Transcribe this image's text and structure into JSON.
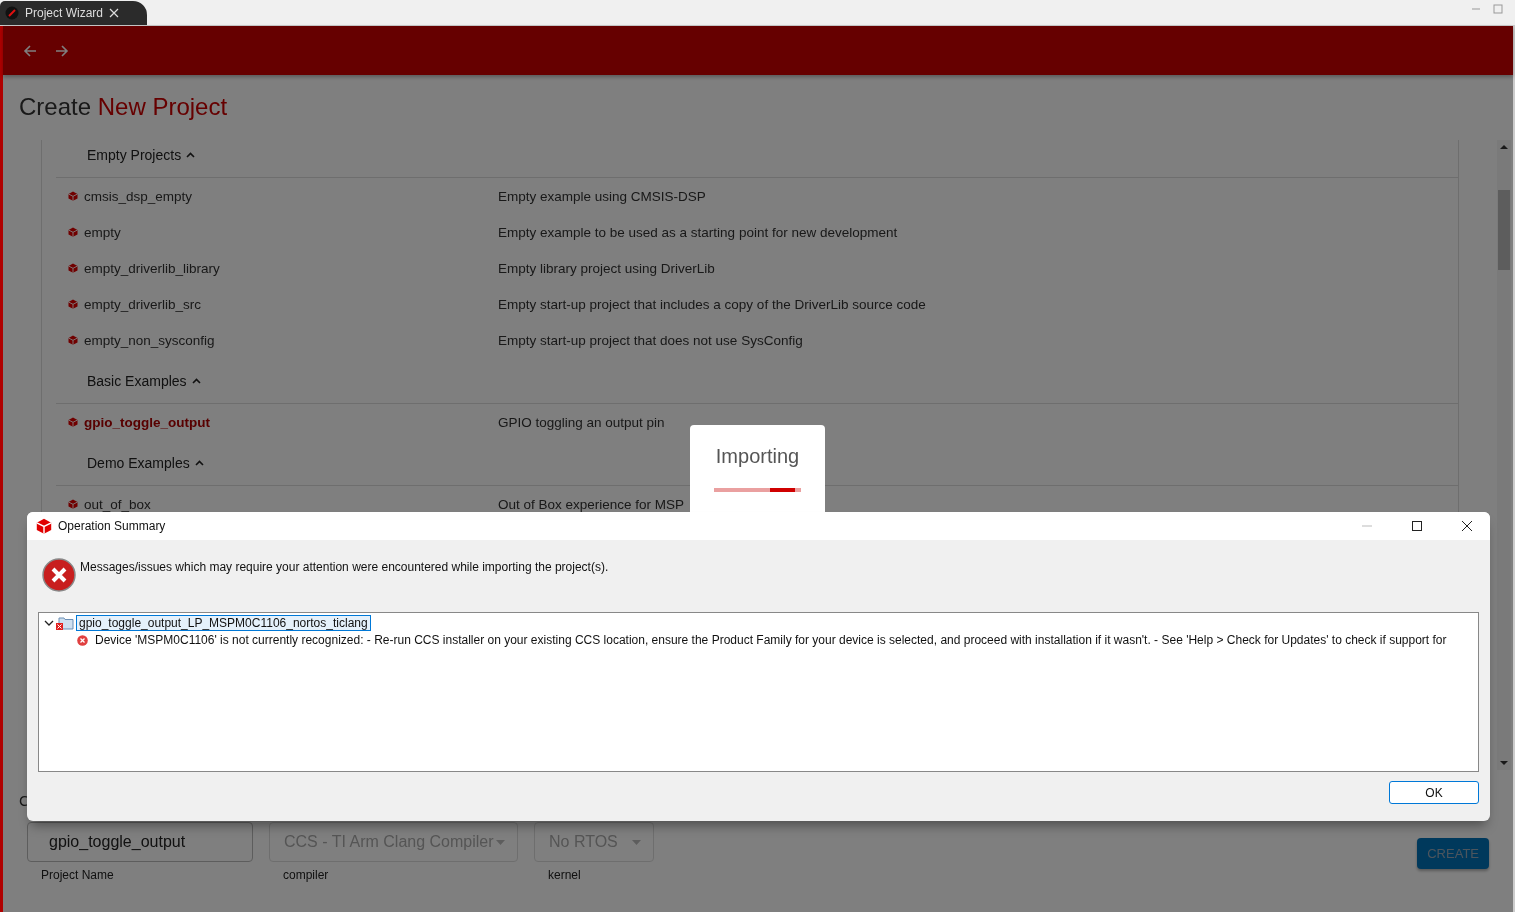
{
  "window": {
    "tab_title": "Project Wizard"
  },
  "page": {
    "title_plain": "Create",
    "title_accent": "New Project",
    "sections": [
      {
        "heading": "Empty Projects",
        "expanded": true,
        "items": [
          {
            "name": "cmsis_dsp_empty",
            "description": "Empty example using CMSIS-DSP",
            "selected": false
          },
          {
            "name": "empty",
            "description": "Empty example to be used as a starting point for new development",
            "selected": false
          },
          {
            "name": "empty_driverlib_library",
            "description": "Empty library project using DriverLib",
            "selected": false
          },
          {
            "name": "empty_driverlib_src",
            "description": "Empty start-up project that includes a copy of the DriverLib source code",
            "selected": false
          },
          {
            "name": "empty_non_sysconfig",
            "description": "Empty start-up project that does not use SysConfig",
            "selected": false
          }
        ]
      },
      {
        "heading": "Basic Examples",
        "expanded": true,
        "items": [
          {
            "name": "gpio_toggle_output",
            "description": "GPIO toggling an output pin",
            "selected": true
          }
        ]
      },
      {
        "heading": "Demo Examples",
        "expanded": true,
        "items": [
          {
            "name": "out_of_box",
            "description": "Out of Box experience for MSP",
            "selected": false
          }
        ]
      }
    ],
    "configure_heading": "C",
    "fields": [
      {
        "kind": "input",
        "value": "gpio_toggle_output",
        "label": "Project Name",
        "disabled": false
      },
      {
        "kind": "select",
        "value": "CCS - TI Arm Clang Compiler",
        "label": "compiler",
        "disabled": true
      },
      {
        "kind": "select",
        "value": "No RTOS",
        "label": "kernel",
        "disabled": true
      }
    ],
    "create_button": {
      "label": "CREATE",
      "disabled": true
    }
  },
  "progress_popup": {
    "title": "Importing"
  },
  "dialog": {
    "title": "Operation Summary",
    "message": "Messages/issues which may require your attention were encountered while importing the project(s).",
    "tree": [
      {
        "label": "gpio_toggle_output_LP_MSPM0C1106_nortos_ticlang",
        "expanded": true,
        "selected": true,
        "children": [
          {
            "label": "Device 'MSPM0C1106' is not currently recognized: - Re-run CCS installer on your existing CCS location, ensure the Product Family for your device is selected, and proceed with installation if it wasn't. - See 'Help > Check for Updates' to check if support for"
          }
        ]
      }
    ],
    "buttons": [
      "OK"
    ]
  }
}
